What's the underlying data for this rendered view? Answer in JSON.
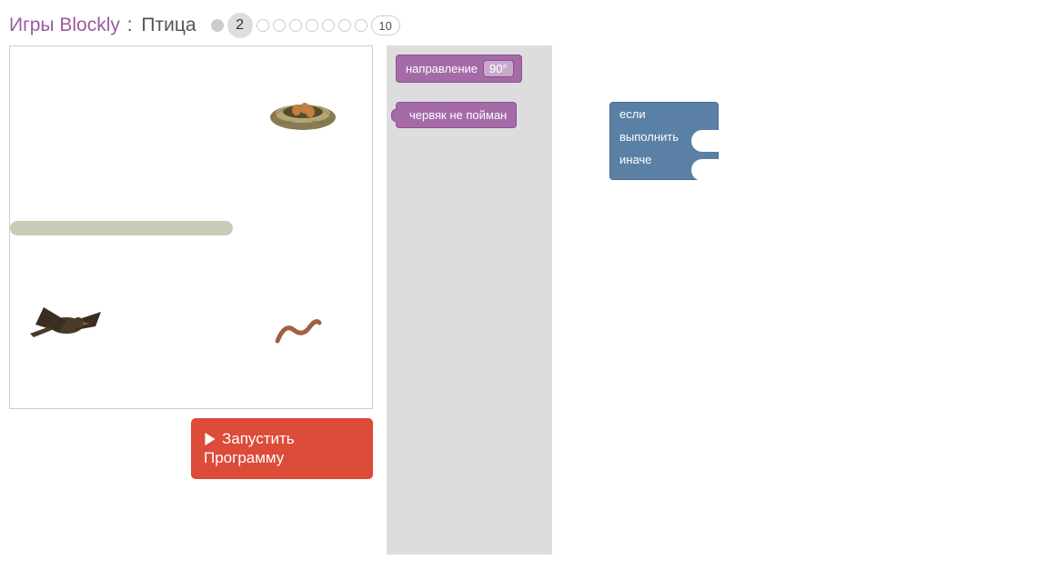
{
  "header": {
    "site_link": "Игры Blockly",
    "separator": ":",
    "game_name": "Птица"
  },
  "levels": {
    "current": "2",
    "last": "10"
  },
  "run_button": {
    "line1": "Запустить",
    "line2": "Программу"
  },
  "blocks": {
    "heading_label": "направление",
    "heading_value": "90°",
    "worm_label": "червяк не пойман",
    "if_label": "если",
    "do_label": "выполнить",
    "else_label": "иначе"
  }
}
